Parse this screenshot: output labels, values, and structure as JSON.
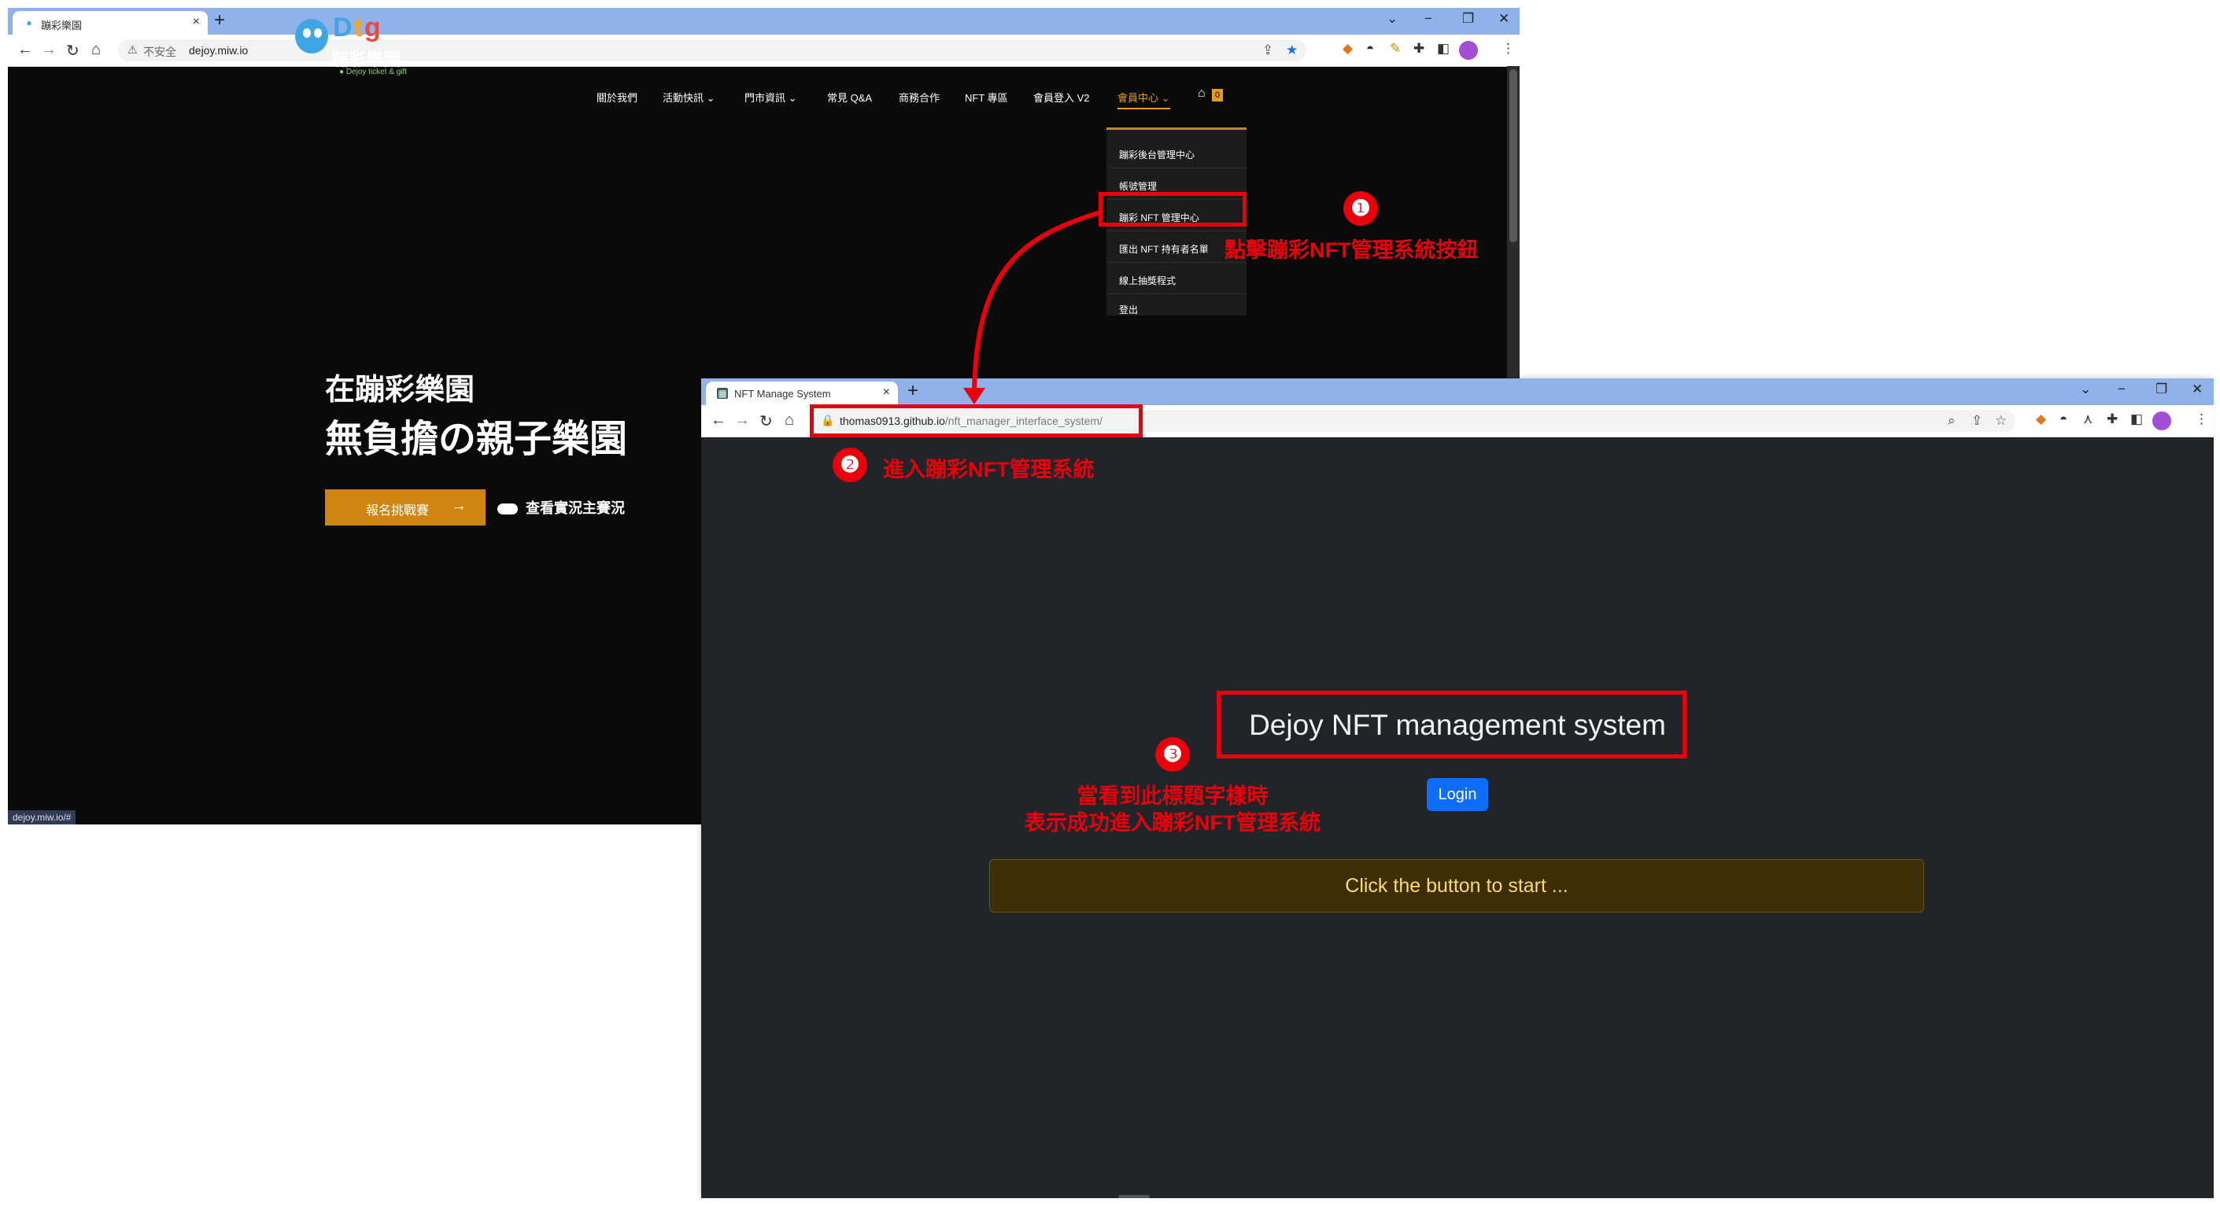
{
  "window1": {
    "tab_title": "蹦彩樂園",
    "favicon": "dtg-favicon",
    "insecure_label": "不安全",
    "url": "dejoy.miw.io",
    "logo": {
      "wordmark": "Dtg",
      "chinese": "蹦彩樂園",
      "tagline": "● Dejoy ticket & gift"
    },
    "menu": [
      {
        "label": "關於我們"
      },
      {
        "label": "活動快訊 ⌄"
      },
      {
        "label": "門市資訊 ⌄"
      },
      {
        "label": "常見 Q&A"
      },
      {
        "label": "商務合作"
      },
      {
        "label": "NFT 專區"
      },
      {
        "label": "會員登入 V2"
      },
      {
        "label": "會員中心 ⌄"
      }
    ],
    "cart_count": "0",
    "dropdown": [
      {
        "label": "蹦彩後台管理中心"
      },
      {
        "label": "帳號管理"
      },
      {
        "label": "蹦彩 NFT 管理中心"
      },
      {
        "label": "匯出 NFT 持有者名單"
      },
      {
        "label": "線上抽獎程式"
      },
      {
        "label": "登出"
      }
    ],
    "hero_line1": "在蹦彩樂園",
    "hero_line2": "無負擔の親子樂園",
    "cta_label": "報名挑戰賽",
    "cta_arrow": "→",
    "live_label": "查看實況主賽況",
    "status_url": "dejoy.miw.io/#"
  },
  "window2": {
    "tab_title": "NFT Manage System",
    "url_host": "thomas0913.github.io",
    "url_path": "/nft_manager_interface_system/",
    "page_title": "Dejoy NFT management system",
    "login_label": "Login",
    "status_message": "Click the button to start ..."
  },
  "annotations": {
    "step1_num": "❶",
    "step1_text": "點擊蹦彩NFT管理系統按鈕",
    "step2_num": "❷",
    "step2_text": "進入蹦彩NFT管理系統",
    "step3_num": "❸",
    "step3_line1": "當看到此標題字樣時",
    "step3_line2": "表示成功進入蹦彩NFT管理系統",
    "color": "#e8000b"
  },
  "colors": {
    "accent_orange": "#cf8512",
    "login_blue": "#0d6efd",
    "alert_yellow": "#ffd966"
  }
}
